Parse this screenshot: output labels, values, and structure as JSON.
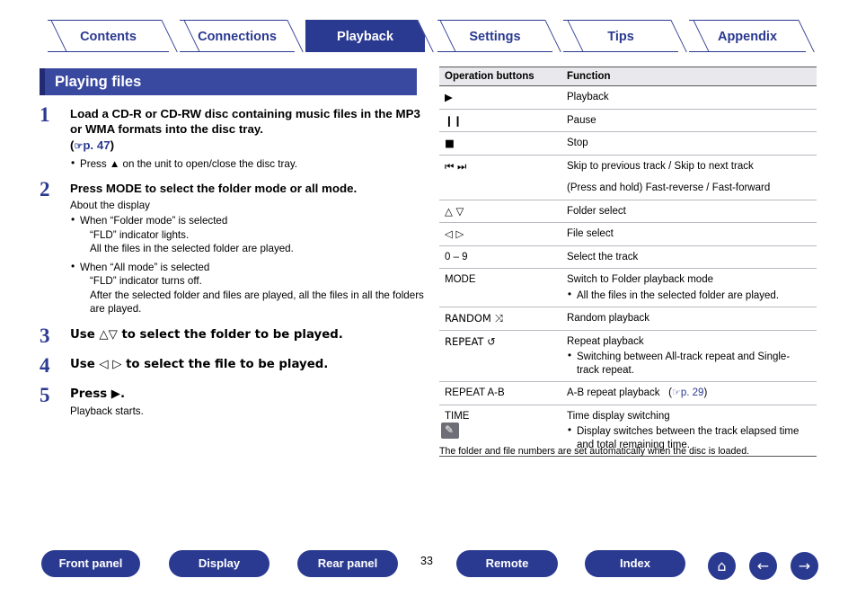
{
  "tabs": [
    {
      "label": "Contents",
      "active": false
    },
    {
      "label": "Connections",
      "active": false
    },
    {
      "label": "Playback",
      "active": true
    },
    {
      "label": "Settings",
      "active": false
    },
    {
      "label": "Tips",
      "active": false
    },
    {
      "label": "Appendix",
      "active": false
    }
  ],
  "section": {
    "title": "Playing files"
  },
  "steps": [
    {
      "number": "1",
      "heading": "Load a CD-R or CD-RW disc containing music files in the MP3 or WMA formats into the disc tray.",
      "link_prefix": "(",
      "link_icon": "☞",
      "link_text": "p. 47",
      "link_suffix": ")",
      "bullets": [
        "Press ▲ on the unit to open/close the disc tray."
      ]
    },
    {
      "number": "2",
      "heading": "Press MODE to select the folder mode or all mode.",
      "intro": "About the display",
      "bullets": [
        {
          "main": "When “Folder mode” is selected",
          "sub": [
            "“FLD” indicator lights.",
            "All the files in the selected folder are played."
          ]
        },
        {
          "main": "When “All mode” is selected",
          "sub": [
            "“FLD” indicator turns off.",
            "After the selected folder and files are played, all the files in all the folders are played."
          ]
        }
      ]
    },
    {
      "number": "3",
      "heading": "Use △▽ to select the folder to be played."
    },
    {
      "number": "4",
      "heading": "Use ◁ ▷ to select the file to be played."
    },
    {
      "number": "5",
      "heading": "Press ▶.",
      "body": "Playback starts."
    }
  ],
  "table": {
    "headers": [
      "Operation buttons",
      "Function"
    ],
    "rows": [
      {
        "button": "▶",
        "function": "Playback"
      },
      {
        "button": "❙❙",
        "function": "Pause"
      },
      {
        "button": "■",
        "function": "Stop"
      },
      {
        "button": "⏮ ⏭",
        "function": "Skip to previous track / Skip to next track",
        "function2": "(Press and hold) Fast-reverse / Fast-forward"
      },
      {
        "button": "△ ▽",
        "function": "Folder select"
      },
      {
        "button": "◁ ▷",
        "function": "File select"
      },
      {
        "button": "0 – 9",
        "function": "Select the track"
      },
      {
        "button": "MODE",
        "function": "Switch to Folder playback mode",
        "bullets": [
          "All the files in the selected folder are played."
        ]
      },
      {
        "button": "RANDOM ⤨",
        "function": "Random playback"
      },
      {
        "button": "REPEAT ↺",
        "function": "Repeat playback",
        "bullets": [
          "Switching between All-track repeat and Single-track repeat."
        ]
      },
      {
        "button": "REPEAT A-B",
        "function": "A-B repeat playback",
        "link_icon": "☞",
        "link_text": "p. 29"
      },
      {
        "button": "TIME",
        "function": "Time display switching",
        "bullets": [
          "Display switches between the track elapsed time and total remaining time."
        ]
      }
    ]
  },
  "note": {
    "icon": "pencil-icon",
    "text": "The folder and file numbers are set automatically when the disc is loaded."
  },
  "footer": {
    "buttons": [
      {
        "label": "Front panel"
      },
      {
        "label": "Display"
      },
      {
        "label": "Rear panel"
      },
      {
        "label": "Remote"
      },
      {
        "label": "Index"
      }
    ],
    "page": "33",
    "icons": [
      {
        "name": "home-icon",
        "glyph": "⌂"
      },
      {
        "name": "back-arrow-icon",
        "glyph": "←"
      },
      {
        "name": "forward-arrow-icon",
        "glyph": "→"
      }
    ]
  }
}
